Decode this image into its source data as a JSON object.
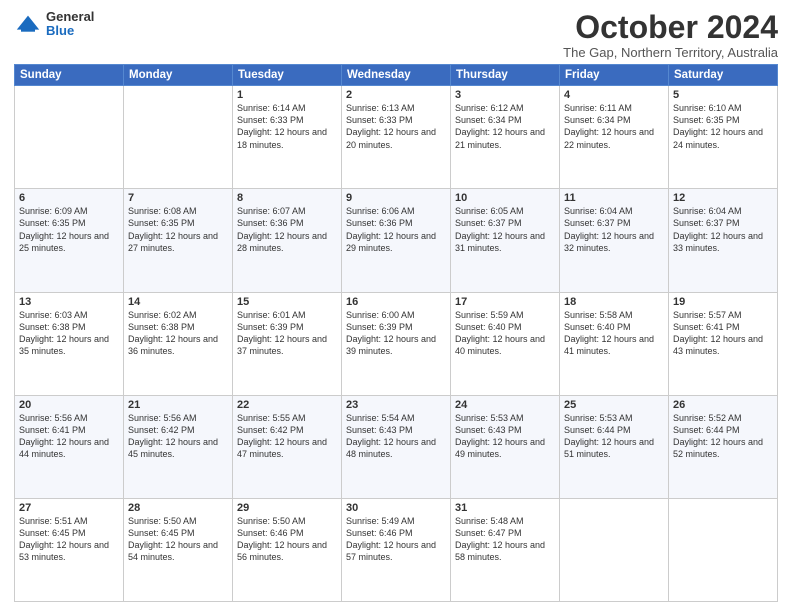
{
  "logo": {
    "general": "General",
    "blue": "Blue"
  },
  "header": {
    "month": "October 2024",
    "location": "The Gap, Northern Territory, Australia"
  },
  "days_of_week": [
    "Sunday",
    "Monday",
    "Tuesday",
    "Wednesday",
    "Thursday",
    "Friday",
    "Saturday"
  ],
  "weeks": [
    [
      {
        "day": "",
        "sunrise": "",
        "sunset": "",
        "daylight": ""
      },
      {
        "day": "",
        "sunrise": "",
        "sunset": "",
        "daylight": ""
      },
      {
        "day": "1",
        "sunrise": "Sunrise: 6:14 AM",
        "sunset": "Sunset: 6:33 PM",
        "daylight": "Daylight: 12 hours and 18 minutes."
      },
      {
        "day": "2",
        "sunrise": "Sunrise: 6:13 AM",
        "sunset": "Sunset: 6:33 PM",
        "daylight": "Daylight: 12 hours and 20 minutes."
      },
      {
        "day": "3",
        "sunrise": "Sunrise: 6:12 AM",
        "sunset": "Sunset: 6:34 PM",
        "daylight": "Daylight: 12 hours and 21 minutes."
      },
      {
        "day": "4",
        "sunrise": "Sunrise: 6:11 AM",
        "sunset": "Sunset: 6:34 PM",
        "daylight": "Daylight: 12 hours and 22 minutes."
      },
      {
        "day": "5",
        "sunrise": "Sunrise: 6:10 AM",
        "sunset": "Sunset: 6:35 PM",
        "daylight": "Daylight: 12 hours and 24 minutes."
      }
    ],
    [
      {
        "day": "6",
        "sunrise": "Sunrise: 6:09 AM",
        "sunset": "Sunset: 6:35 PM",
        "daylight": "Daylight: 12 hours and 25 minutes."
      },
      {
        "day": "7",
        "sunrise": "Sunrise: 6:08 AM",
        "sunset": "Sunset: 6:35 PM",
        "daylight": "Daylight: 12 hours and 27 minutes."
      },
      {
        "day": "8",
        "sunrise": "Sunrise: 6:07 AM",
        "sunset": "Sunset: 6:36 PM",
        "daylight": "Daylight: 12 hours and 28 minutes."
      },
      {
        "day": "9",
        "sunrise": "Sunrise: 6:06 AM",
        "sunset": "Sunset: 6:36 PM",
        "daylight": "Daylight: 12 hours and 29 minutes."
      },
      {
        "day": "10",
        "sunrise": "Sunrise: 6:05 AM",
        "sunset": "Sunset: 6:37 PM",
        "daylight": "Daylight: 12 hours and 31 minutes."
      },
      {
        "day": "11",
        "sunrise": "Sunrise: 6:04 AM",
        "sunset": "Sunset: 6:37 PM",
        "daylight": "Daylight: 12 hours and 32 minutes."
      },
      {
        "day": "12",
        "sunrise": "Sunrise: 6:04 AM",
        "sunset": "Sunset: 6:37 PM",
        "daylight": "Daylight: 12 hours and 33 minutes."
      }
    ],
    [
      {
        "day": "13",
        "sunrise": "Sunrise: 6:03 AM",
        "sunset": "Sunset: 6:38 PM",
        "daylight": "Daylight: 12 hours and 35 minutes."
      },
      {
        "day": "14",
        "sunrise": "Sunrise: 6:02 AM",
        "sunset": "Sunset: 6:38 PM",
        "daylight": "Daylight: 12 hours and 36 minutes."
      },
      {
        "day": "15",
        "sunrise": "Sunrise: 6:01 AM",
        "sunset": "Sunset: 6:39 PM",
        "daylight": "Daylight: 12 hours and 37 minutes."
      },
      {
        "day": "16",
        "sunrise": "Sunrise: 6:00 AM",
        "sunset": "Sunset: 6:39 PM",
        "daylight": "Daylight: 12 hours and 39 minutes."
      },
      {
        "day": "17",
        "sunrise": "Sunrise: 5:59 AM",
        "sunset": "Sunset: 6:40 PM",
        "daylight": "Daylight: 12 hours and 40 minutes."
      },
      {
        "day": "18",
        "sunrise": "Sunrise: 5:58 AM",
        "sunset": "Sunset: 6:40 PM",
        "daylight": "Daylight: 12 hours and 41 minutes."
      },
      {
        "day": "19",
        "sunrise": "Sunrise: 5:57 AM",
        "sunset": "Sunset: 6:41 PM",
        "daylight": "Daylight: 12 hours and 43 minutes."
      }
    ],
    [
      {
        "day": "20",
        "sunrise": "Sunrise: 5:56 AM",
        "sunset": "Sunset: 6:41 PM",
        "daylight": "Daylight: 12 hours and 44 minutes."
      },
      {
        "day": "21",
        "sunrise": "Sunrise: 5:56 AM",
        "sunset": "Sunset: 6:42 PM",
        "daylight": "Daylight: 12 hours and 45 minutes."
      },
      {
        "day": "22",
        "sunrise": "Sunrise: 5:55 AM",
        "sunset": "Sunset: 6:42 PM",
        "daylight": "Daylight: 12 hours and 47 minutes."
      },
      {
        "day": "23",
        "sunrise": "Sunrise: 5:54 AM",
        "sunset": "Sunset: 6:43 PM",
        "daylight": "Daylight: 12 hours and 48 minutes."
      },
      {
        "day": "24",
        "sunrise": "Sunrise: 5:53 AM",
        "sunset": "Sunset: 6:43 PM",
        "daylight": "Daylight: 12 hours and 49 minutes."
      },
      {
        "day": "25",
        "sunrise": "Sunrise: 5:53 AM",
        "sunset": "Sunset: 6:44 PM",
        "daylight": "Daylight: 12 hours and 51 minutes."
      },
      {
        "day": "26",
        "sunrise": "Sunrise: 5:52 AM",
        "sunset": "Sunset: 6:44 PM",
        "daylight": "Daylight: 12 hours and 52 minutes."
      }
    ],
    [
      {
        "day": "27",
        "sunrise": "Sunrise: 5:51 AM",
        "sunset": "Sunset: 6:45 PM",
        "daylight": "Daylight: 12 hours and 53 minutes."
      },
      {
        "day": "28",
        "sunrise": "Sunrise: 5:50 AM",
        "sunset": "Sunset: 6:45 PM",
        "daylight": "Daylight: 12 hours and 54 minutes."
      },
      {
        "day": "29",
        "sunrise": "Sunrise: 5:50 AM",
        "sunset": "Sunset: 6:46 PM",
        "daylight": "Daylight: 12 hours and 56 minutes."
      },
      {
        "day": "30",
        "sunrise": "Sunrise: 5:49 AM",
        "sunset": "Sunset: 6:46 PM",
        "daylight": "Daylight: 12 hours and 57 minutes."
      },
      {
        "day": "31",
        "sunrise": "Sunrise: 5:48 AM",
        "sunset": "Sunset: 6:47 PM",
        "daylight": "Daylight: 12 hours and 58 minutes."
      },
      {
        "day": "",
        "sunrise": "",
        "sunset": "",
        "daylight": ""
      },
      {
        "day": "",
        "sunrise": "",
        "sunset": "",
        "daylight": ""
      }
    ]
  ]
}
